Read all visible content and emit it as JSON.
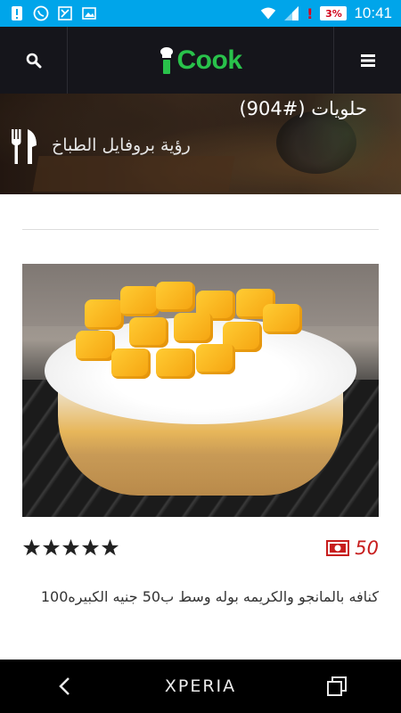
{
  "status_bar": {
    "battery": "3%",
    "time": "10:41",
    "alert": "!"
  },
  "header": {
    "logo_text": "Cook",
    "logo_prefix": "i"
  },
  "banner": {
    "category_title": "حلويات (#904)",
    "chef_profile_label": "رؤية بروفايل الطباخ"
  },
  "recipe": {
    "rating_stars": 5,
    "price": "50",
    "description": "كنافه بالمانجو والكريمه بوله وسط ب50 جنيه الكبيره100"
  },
  "navbar": {
    "brand": "XPERIA"
  },
  "colors": {
    "status_bar": "#00a5ea",
    "header_bg": "#15151b",
    "logo_green": "#29c24b",
    "price_red": "#c71d1d"
  }
}
